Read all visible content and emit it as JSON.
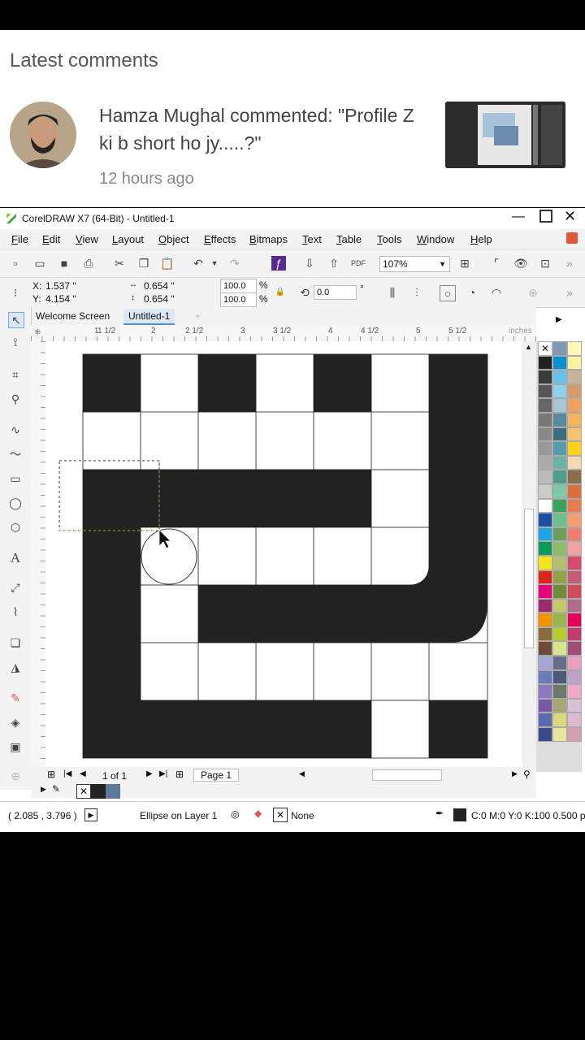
{
  "comments": {
    "section_title": "Latest comments",
    "comment_text": "Hamza Mughal commented: \"Profile Z ki b short ho jy.....?\"",
    "time": "12 hours ago"
  },
  "app": {
    "title": "CorelDRAW X7 (64-Bit) - Untitled-1",
    "menu": [
      "File",
      "Edit",
      "View",
      "Layout",
      "Object",
      "Effects",
      "Bitmaps",
      "Text",
      "Table",
      "Tools",
      "Window",
      "Help"
    ],
    "zoom": "107%",
    "x_label": "X:",
    "x_value": "1.537 \"",
    "y_label": "Y:",
    "y_value": "4.154 \"",
    "w_value": "0.654 \"",
    "h_value": "0.654 \"",
    "scale_w": "100.0",
    "scale_h": "100.0",
    "pct1": "%",
    "pct2": "%",
    "rotation": "0.0",
    "degree": "°",
    "tabs": [
      "Welcome Screen",
      "Untitled-1"
    ],
    "ruler_labels": [
      "1",
      "1 1/2",
      "2",
      "2 1/2",
      "3",
      "3 1/2",
      "4",
      "4 1/2",
      "5",
      "5 1/2"
    ],
    "ruler_unit": "inches",
    "page_count": "1 of 1",
    "page_tab": "Page 1",
    "status_coords": "( 2.085 , 3.796 )",
    "status_object": "Ellipse on Layer 1",
    "status_fill_none": "None",
    "status_color": "C:0 M:0 Y:0 K:100  0.500 p",
    "palette_colors": [
      "#ffffff",
      "#7f97b3",
      "#fff7b3",
      "#222222",
      "#0a8fcf",
      "#fdf2a0",
      "#3a3a3a",
      "#67c1e8",
      "#c8b49b",
      "#555555",
      "#8fd0ea",
      "#d99a6a",
      "#666666",
      "#a6c6d6",
      "#f0a060",
      "#777777",
      "#5a8aa0",
      "#f7b25a",
      "#888888",
      "#3b6f7d",
      "#f7c36a",
      "#999999",
      "#569bb0",
      "#fcd116",
      "#aaaaaa",
      "#6ab3a5",
      "#f3d9b1",
      "#bbbbbb",
      "#4d9e8a",
      "#8a6e4b",
      "#cccccc",
      "#7fc7a5",
      "#d96f3a",
      "#ffffff",
      "#3aa35b",
      "#ea7a4b",
      "#1f4fa3",
      "#6fc08a",
      "#f69e70",
      "#1ea5e6",
      "#6a9e5a",
      "#f07d6e",
      "#0d9a5a",
      "#8bbd6d",
      "#f0a3a0",
      "#f7e51c",
      "#b0c070",
      "#d94a6a",
      "#e2231a",
      "#8fa24a",
      "#c75a74",
      "#e6007e",
      "#6e8c3c",
      "#d04a5a",
      "#9c2a6e",
      "#c2c96a",
      "#b26a8a",
      "#f39200",
      "#9ab54a",
      "#e6005a",
      "#8b6b3a",
      "#b5cf2a",
      "#c43a6a",
      "#6e4a3a",
      "#d8e58a",
      "#a04a7a",
      "#a6a6d8",
      "#6a6a8a",
      "#e8a0c0",
      "#6b7bb8",
      "#4a5a7a",
      "#c0a0c8",
      "#8a7ac2",
      "#6a7a6a",
      "#f0a8c8",
      "#7a5aa6",
      "#a6a670",
      "#d8c0d8",
      "#5a6ab0",
      "#d8d878",
      "#e0b8d0",
      "#3a4a8a",
      "#e6e6a0",
      "#d0a0b0"
    ]
  }
}
